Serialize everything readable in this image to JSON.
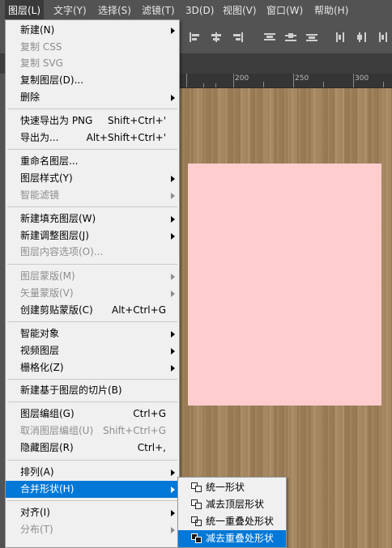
{
  "menubar": {
    "items": [
      {
        "label": "图层(L)"
      },
      {
        "label": "文字(Y)"
      },
      {
        "label": "选择(S)"
      },
      {
        "label": "滤镜(T)"
      },
      {
        "label": "3D(D)"
      },
      {
        "label": "视图(V)"
      },
      {
        "label": "窗口(W)"
      },
      {
        "label": "帮助(H)"
      }
    ]
  },
  "ruler": {
    "ticks": [
      "200",
      "250",
      "300"
    ]
  },
  "layer_menu": {
    "items": [
      {
        "label": "新建(N)",
        "shortcut": ""
      },
      {
        "label": "复制 CSS",
        "shortcut": ""
      },
      {
        "label": "复制 SVG",
        "shortcut": ""
      },
      {
        "label": "复制图层(D)...",
        "shortcut": ""
      },
      {
        "label": "删除",
        "shortcut": ""
      },
      {
        "label": "快速导出为 PNG",
        "shortcut": "Shift+Ctrl+'"
      },
      {
        "label": "导出为...",
        "shortcut": "Alt+Shift+Ctrl+'"
      },
      {
        "label": "重命名图层...",
        "shortcut": ""
      },
      {
        "label": "图层样式(Y)",
        "shortcut": ""
      },
      {
        "label": "智能滤镜",
        "shortcut": ""
      },
      {
        "label": "新建填充图层(W)",
        "shortcut": ""
      },
      {
        "label": "新建调整图层(J)",
        "shortcut": ""
      },
      {
        "label": "图层内容选项(O)...",
        "shortcut": ""
      },
      {
        "label": "图层蒙版(M)",
        "shortcut": ""
      },
      {
        "label": "矢量蒙版(V)",
        "shortcut": ""
      },
      {
        "label": "创建剪贴蒙版(C)",
        "shortcut": "Alt+Ctrl+G"
      },
      {
        "label": "智能对象",
        "shortcut": ""
      },
      {
        "label": "视频图层",
        "shortcut": ""
      },
      {
        "label": "栅格化(Z)",
        "shortcut": ""
      },
      {
        "label": "新建基于图层的切片(B)",
        "shortcut": ""
      },
      {
        "label": "图层编组(G)",
        "shortcut": "Ctrl+G"
      },
      {
        "label": "取消图层编组(U)",
        "shortcut": "Shift+Ctrl+G"
      },
      {
        "label": "隐藏图层(R)",
        "shortcut": "Ctrl+,"
      },
      {
        "label": "排列(A)",
        "shortcut": ""
      },
      {
        "label": "合并形状(H)",
        "shortcut": ""
      },
      {
        "label": "对齐(I)",
        "shortcut": ""
      },
      {
        "label": "分布(T)",
        "shortcut": ""
      }
    ]
  },
  "combine_shapes_submenu": {
    "items": [
      {
        "label": "统一形状",
        "icon": "unite-shapes-icon"
      },
      {
        "label": "减去顶层形状",
        "icon": "subtract-front-shape-icon"
      },
      {
        "label": "统一重叠处形状",
        "icon": "intersect-shapes-icon"
      },
      {
        "label": "减去重叠处形状",
        "icon": "exclude-overlapping-icon"
      }
    ]
  },
  "colors": {
    "highlight": "#0078d7",
    "menu_bg": "#f0f0f0",
    "canvas_shape": "#ffcdcd",
    "ui_dark": "#535353"
  }
}
